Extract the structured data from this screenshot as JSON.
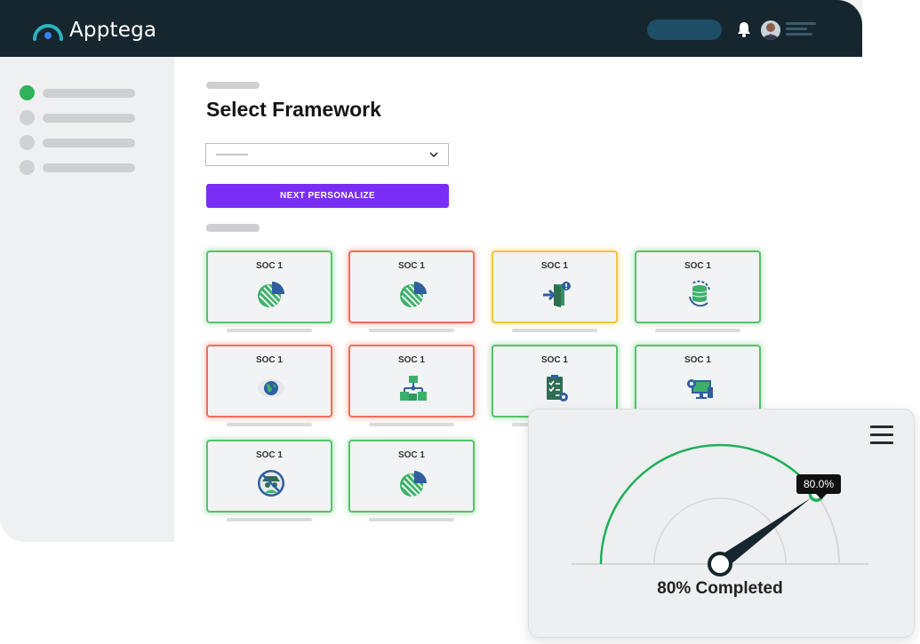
{
  "header": {
    "brand": "Apptega",
    "brand_color": "#2bb3c0"
  },
  "page": {
    "title": "Select Framework",
    "next_button": "NEXT PERSONALIZE",
    "accent": "#7a2df5"
  },
  "cards": [
    {
      "label": "SOC 1",
      "status": "green",
      "icon": "pie-chart-icon"
    },
    {
      "label": "SOC 1",
      "status": "red",
      "icon": "pie-chart-icon"
    },
    {
      "label": "SOC 1",
      "status": "yellow",
      "icon": "door-enter-icon"
    },
    {
      "label": "SOC 1",
      "status": "green",
      "icon": "database-sync-icon"
    },
    {
      "label": "SOC 1",
      "status": "red",
      "icon": "globe-eye-icon"
    },
    {
      "label": "SOC 1",
      "status": "red",
      "icon": "network-boxes-icon"
    },
    {
      "label": "SOC 1",
      "status": "green",
      "icon": "clipboard-check-icon"
    },
    {
      "label": "SOC 1",
      "status": "green",
      "icon": "monitor-gear-icon"
    },
    {
      "label": "SOC 1",
      "status": "green",
      "icon": "spy-icon"
    },
    {
      "label": "SOC 1",
      "status": "green",
      "icon": "pie-chart-icon"
    }
  ],
  "status_colors": {
    "green": "#56c26a",
    "red": "#ee6f5a",
    "yellow": "#f2c53d"
  },
  "gauge": {
    "value_percent": 80,
    "tooltip": "80.0%",
    "label": "80% Completed",
    "arc_color": "#1fb05a"
  }
}
